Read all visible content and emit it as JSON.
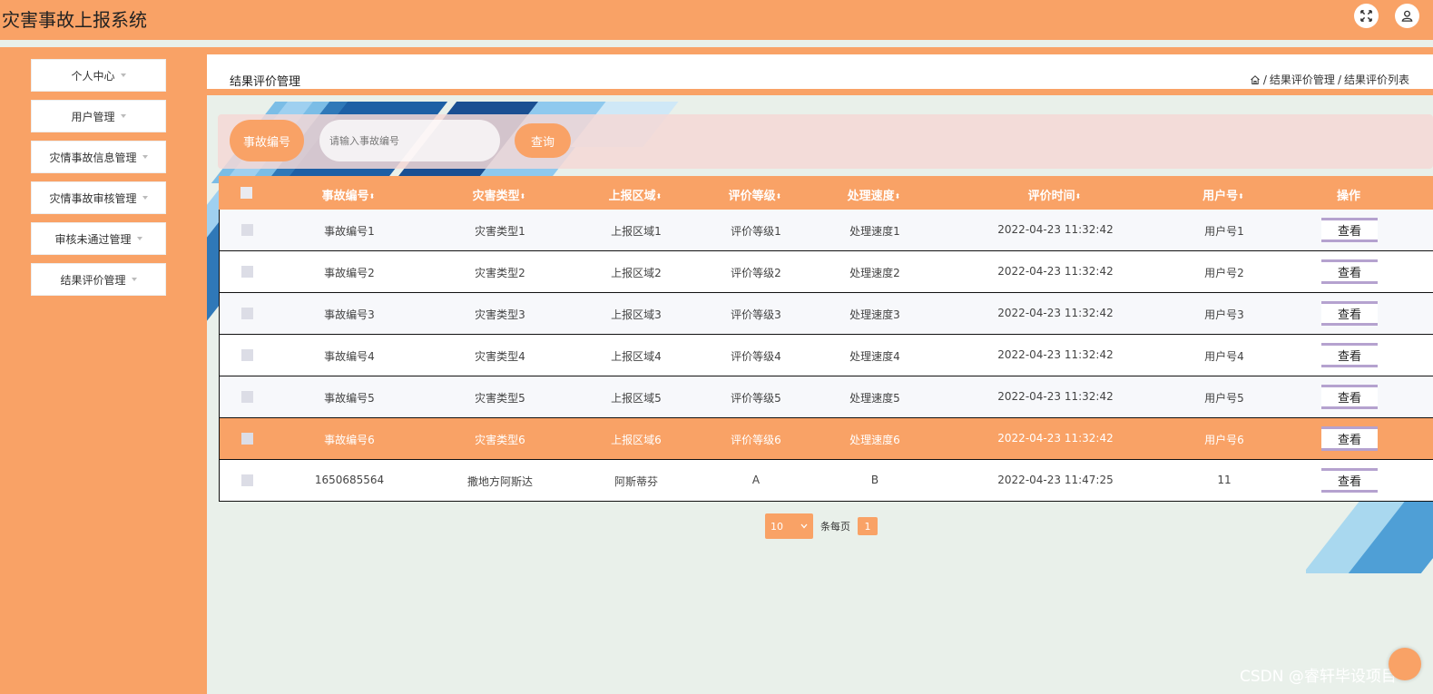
{
  "app": {
    "title": "灾害事故上报系统"
  },
  "header_icons": [
    "fullscreen-icon",
    "user-icon"
  ],
  "sidebar": {
    "items": [
      {
        "label": "个人中心"
      },
      {
        "label": "用户管理"
      },
      {
        "label": "灾情事故信息管理"
      },
      {
        "label": "灾情事故审核管理"
      },
      {
        "label": "审核未通过管理"
      },
      {
        "label": "结果评价管理"
      }
    ]
  },
  "page": {
    "title": "结果评价管理",
    "breadcrumb": {
      "sep1": "/",
      "level1": "结果评价管理",
      "sep2": "/",
      "level2": "结果评价列表"
    }
  },
  "search": {
    "label": "事故编号",
    "placeholder": "请输入事故编号",
    "button": "查询"
  },
  "table": {
    "columns": [
      "事故编号",
      "灾害类型",
      "上报区域",
      "评价等级",
      "处理速度",
      "评价时间",
      "用户号",
      "操作"
    ],
    "sort_glyph": "⬍",
    "action_label": "查看",
    "rows": [
      {
        "id": "事故编号1",
        "type": "灾害类型1",
        "area": "上报区域1",
        "grade": "评价等级1",
        "speed": "处理速度1",
        "time": "2022-04-23 11:32:42",
        "user": "用户号1"
      },
      {
        "id": "事故编号2",
        "type": "灾害类型2",
        "area": "上报区域2",
        "grade": "评价等级2",
        "speed": "处理速度2",
        "time": "2022-04-23 11:32:42",
        "user": "用户号2"
      },
      {
        "id": "事故编号3",
        "type": "灾害类型3",
        "area": "上报区域3",
        "grade": "评价等级3",
        "speed": "处理速度3",
        "time": "2022-04-23 11:32:42",
        "user": "用户号3"
      },
      {
        "id": "事故编号4",
        "type": "灾害类型4",
        "area": "上报区域4",
        "grade": "评价等级4",
        "speed": "处理速度4",
        "time": "2022-04-23 11:32:42",
        "user": "用户号4"
      },
      {
        "id": "事故编号5",
        "type": "灾害类型5",
        "area": "上报区域5",
        "grade": "评价等级5",
        "speed": "处理速度5",
        "time": "2022-04-23 11:32:42",
        "user": "用户号5"
      },
      {
        "id": "事故编号6",
        "type": "灾害类型6",
        "area": "上报区域6",
        "grade": "评价等级6",
        "speed": "处理速度6",
        "time": "2022-04-23 11:32:42",
        "user": "用户号6"
      },
      {
        "id": "1650685564",
        "type": "撒地方阿斯达",
        "area": "阿斯蒂芬",
        "grade": "A",
        "speed": "B",
        "time": "2022-04-23 11:47:25",
        "user": "11"
      }
    ]
  },
  "pagination": {
    "page_size": "10",
    "per_page_text": "条每页",
    "current_page": "1"
  },
  "watermark": "CSDN @睿轩毕设项目",
  "colors": {
    "primary": "#f9a266",
    "background": "#e9f0ea",
    "accent_border": "#b5a2cf"
  }
}
